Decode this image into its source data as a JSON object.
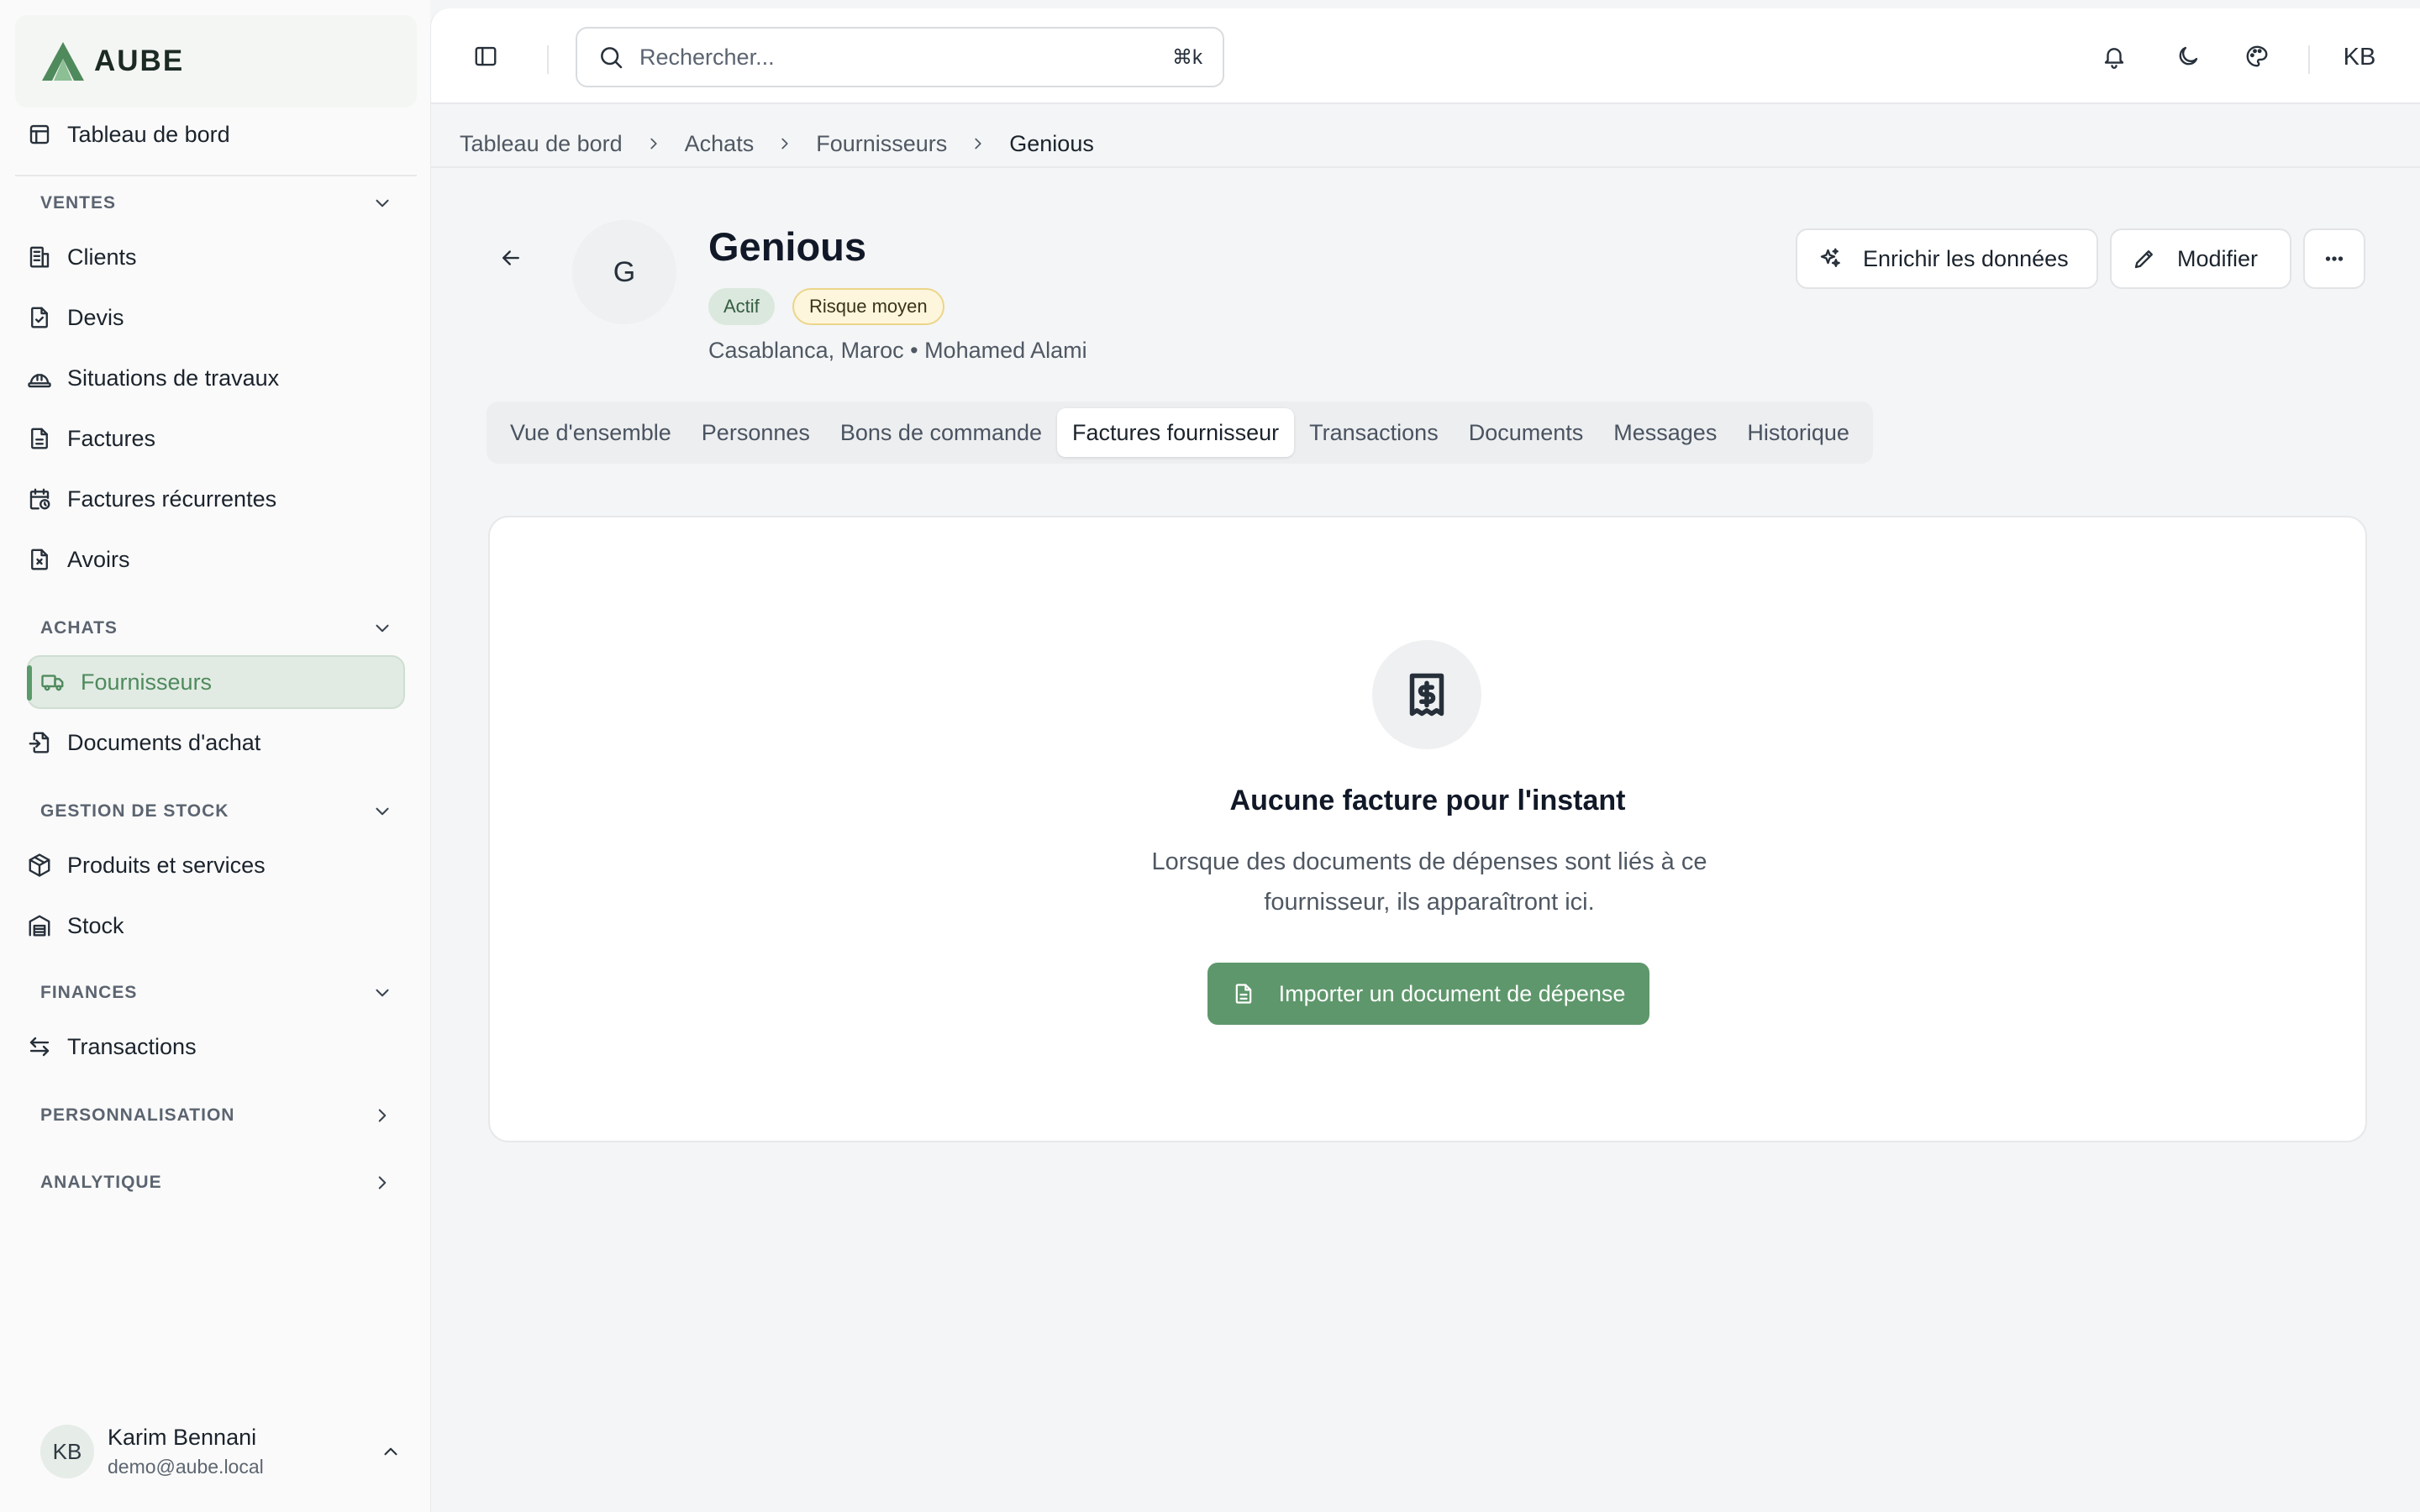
{
  "app": {
    "name": "AUBE",
    "brand_color": "#5e976b"
  },
  "sidebar": {
    "dashboard": "Tableau de bord",
    "sections": {
      "ventes": "VENTES",
      "achats": "ACHATS",
      "stock": "GESTION DE STOCK",
      "finances": "FINANCES",
      "perso": "PERSONNALISATION",
      "analytique": "ANALYTIQUE"
    },
    "items": {
      "clients": "Clients",
      "devis": "Devis",
      "situations": "Situations de travaux",
      "factures": "Factures",
      "recurrentes": "Factures récurrentes",
      "avoirs": "Avoirs",
      "fournisseurs": "Fournisseurs",
      "documents_achat": "Documents d'achat",
      "produits": "Produits et services",
      "stock": "Stock",
      "transactions": "Transactions"
    },
    "user": {
      "initials": "KB",
      "name": "Karim Bennani",
      "email": "demo@aube.local"
    }
  },
  "topbar": {
    "search_placeholder": "Rechercher...",
    "shortcut": "⌘k",
    "user_initials": "KB"
  },
  "breadcrumb": [
    "Tableau de bord",
    "Achats",
    "Fournisseurs",
    "Genious"
  ],
  "supplier": {
    "initial": "G",
    "name": "Genious",
    "status": "Actif",
    "risk": "Risque moyen",
    "meta": "Casablanca, Maroc • Mohamed Alami"
  },
  "actions": {
    "enrich": "Enrichir les données",
    "edit": "Modifier"
  },
  "tabs": [
    "Vue d'ensemble",
    "Personnes",
    "Bons de commande",
    "Factures fournisseur",
    "Transactions",
    "Documents",
    "Messages",
    "Historique"
  ],
  "active_tab": "Factures fournisseur",
  "empty_state": {
    "title": "Aucune facture pour l'instant",
    "line1": "Lorsque des documents de dépenses sont liés à ce",
    "line2": "fournisseur, ils apparaîtront ici.",
    "button": "Importer un document de dépense"
  }
}
